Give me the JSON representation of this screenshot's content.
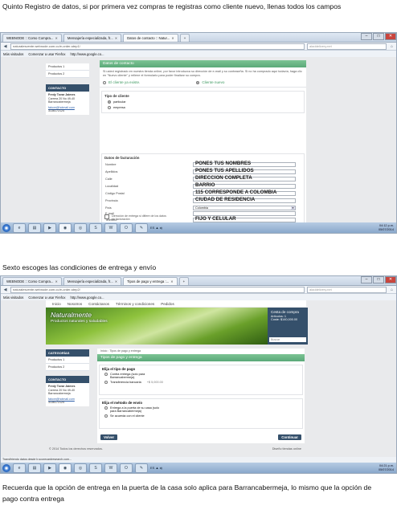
{
  "captions": {
    "step5": "Quinto Registro de datos, si por primera vez compras te registras como cliente nuevo, llenas todos los campos",
    "step6": "Sexto escoges las condiciones de entrega y envío",
    "note": "Recuerda que la opción de entrega en la puerta de la casa solo aplica para Barrancabermeja, lo mismo que la opción de pago contra entrega"
  },
  "browser": {
    "tabs": [
      "WEBNODE :: Como Compra...",
      "Mensajería especializada, fr...",
      "Datos de contacto :: Natur..."
    ],
    "tabs2": [
      "WEBNODE :: Como Compra...",
      "Mensajería especializada, fr...",
      "Tipos de pago y entrega :..."
    ],
    "url1": "naturalesvente.webnode.com.co/e-order-step1/",
    "url2": "naturalesvente.webnode.com.co/e-order-step2/",
    "search_placeholder": "aladdelivery.net",
    "bookmarks": [
      "Más visitados",
      "Comenzar a usar Firefox",
      "http://www.google.co..."
    ]
  },
  "sidebar": {
    "products": [
      "Productos 1",
      "Productos 2"
    ],
    "category_title": "CATEGORÍAS",
    "contact_title": "CONTACTO",
    "contact_lines": [
      "Fredy Tovar Jaimes",
      "Carrera 20 No 49-40",
      "Barrancabermeja"
    ],
    "contact_email": "fatove@hotmail.com",
    "contact_phone": "3136172124"
  },
  "shot1": {
    "section_title": "Datos de contacto",
    "intro": "Si usted registrado en nuestra tienda online, por favor introduzca su dirección de e-mail y su contraseña. Si no ha comprado aquí todavía, haga clic en \"Nuevo cliente\" y rellene el formulario para poder finalizar su compra.",
    "existing_client": "El cliente ya existe.",
    "new_client": "Cliente nuevo",
    "client_type_title": "Tipo de cliente",
    "client_types": [
      "particular",
      "empresa"
    ],
    "billing_title": "Datos de facturación",
    "fields": [
      {
        "label": "Nombre",
        "value": "PONES TUS NOMBRES"
      },
      {
        "label": "Apellidos",
        "value": "PONES TUS APELLIDOS"
      },
      {
        "label": "Calle",
        "value": "DIRECCION COMPLETA"
      },
      {
        "label": "Localidad",
        "value": "BARRIO"
      },
      {
        "label": "Código Postal",
        "value": "115 CORRESPONDE A COLOMBIA"
      },
      {
        "label": "Provincia",
        "value": "CIUDAD DE RESIDENCIA"
      },
      {
        "label": "País",
        "value": "Colombia"
      },
      {
        "label": "E-mail",
        "value": ""
      },
      {
        "label": "Teléfono",
        "value": "FIJO Y CELULAR"
      }
    ],
    "delivery_note": "Dirección de entrega si difiere de los datos de facturación",
    "clock": [
      "04:12 p.m.",
      "05/07/2014"
    ]
  },
  "shot2": {
    "nav": [
      "Inicio",
      "Nosotros",
      "Contáctanos",
      "Términos y condiciones",
      "Pedidos"
    ],
    "brand": "Naturalmente",
    "tagline": "Productos naturales y saludables",
    "cart_title": "Cesta de compra",
    "cart_items_label": "Artículos: 1",
    "cart_cost_label": "Coste: $140,000.00",
    "search_placeholder": "Buscar",
    "breadcrumb": "Inicio : Tipos de pago y entrega",
    "section_title": "Tipos de pago y entrega",
    "payment_title": "Elija el tipo de pago",
    "payment_options": [
      "Contra entrega (solo para Barrancabermeja)",
      "Transferencia bancaria"
    ],
    "payment_extra": "+$ 5,000.00",
    "shipping_title": "Elija el método de envío",
    "shipping_options": [
      "Entrega a la puerta de su casa (solo para Barrancabermeja)",
      "Se acuerda con el cliente"
    ],
    "back_button": "Volver",
    "continue_button": "Continuar",
    "footer_left": "© 2014 Todos los derechos reservados.",
    "footer_right": "Diseño tiendas online",
    "status": "Transfiriendo datos desde b.scorecardresearch.com...",
    "clock": [
      "04:21 p.m.",
      "05/07/2014"
    ]
  }
}
